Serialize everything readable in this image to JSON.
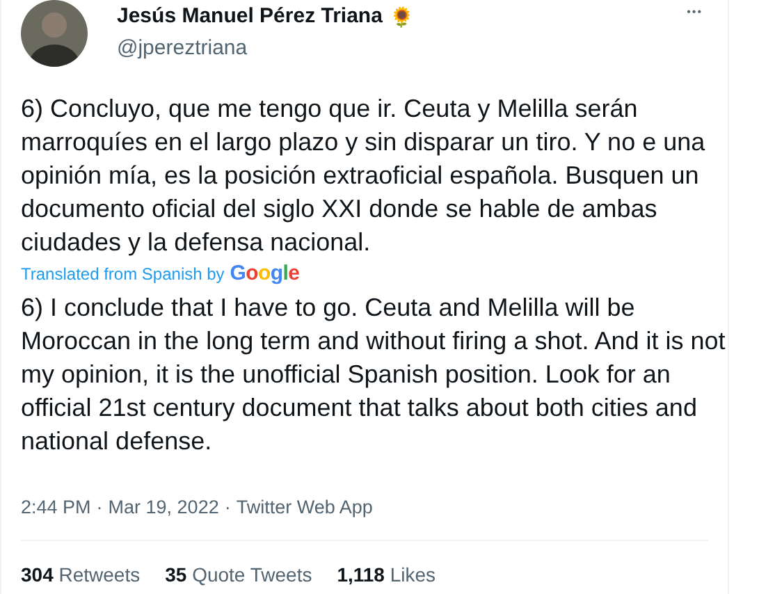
{
  "author": {
    "name": "Jesús Manuel Pérez Triana",
    "emoji": "🌻",
    "handle": "@jpereztriana"
  },
  "more": "•••",
  "original_text": "6) Concluyo, que me tengo que ir. Ceuta y Melilla serán marroquíes en el largo plazo y sin disparar un tiro. Y no e una opinión mía, es la posición extraoficial española. Busquen un documento oficial del siglo XXI donde se hable de ambas ciudades y la defensa nacional.",
  "translation_note": {
    "label": "Translated from Spanish by",
    "brand": "Google"
  },
  "translated_text": "6) I conclude that I have to go. Ceuta and Melilla will be Moroccan in the long term and without firing a shot. And it is not my opinion, it is the unofficial Spanish position. Look for an official 21st century document that talks about both cities and national defense.",
  "meta": {
    "time": "2:44 PM",
    "separator": "·",
    "date": "Mar 19, 2022",
    "source": "Twitter Web App"
  },
  "stats": [
    {
      "count": "304",
      "label": "Retweets"
    },
    {
      "count": "35",
      "label": "Quote Tweets"
    },
    {
      "count": "1,118",
      "label": "Likes"
    }
  ]
}
